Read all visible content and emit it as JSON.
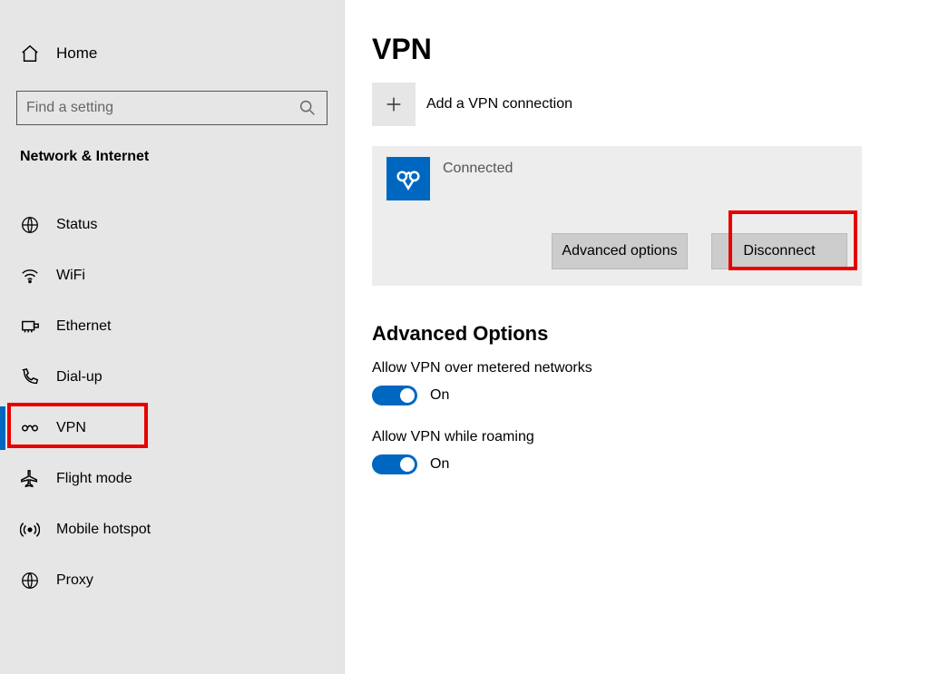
{
  "sidebar": {
    "home_label": "Home",
    "search_placeholder": "Find a setting",
    "section_label": "Network & Internet",
    "items": [
      {
        "label": "Status"
      },
      {
        "label": "WiFi"
      },
      {
        "label": "Ethernet"
      },
      {
        "label": "Dial-up"
      },
      {
        "label": "VPN"
      },
      {
        "label": "Flight mode"
      },
      {
        "label": "Mobile hotspot"
      },
      {
        "label": "Proxy"
      }
    ]
  },
  "main": {
    "title": "VPN",
    "add_label": "Add a VPN connection",
    "connection": {
      "name": "",
      "status": "Connected",
      "advanced_btn": "Advanced options",
      "disconnect_btn": "Disconnect"
    },
    "advanced_section_title": "Advanced Options",
    "options": [
      {
        "label": "Allow VPN over metered networks",
        "state": "On"
      },
      {
        "label": "Allow VPN while roaming",
        "state": "On"
      }
    ]
  }
}
